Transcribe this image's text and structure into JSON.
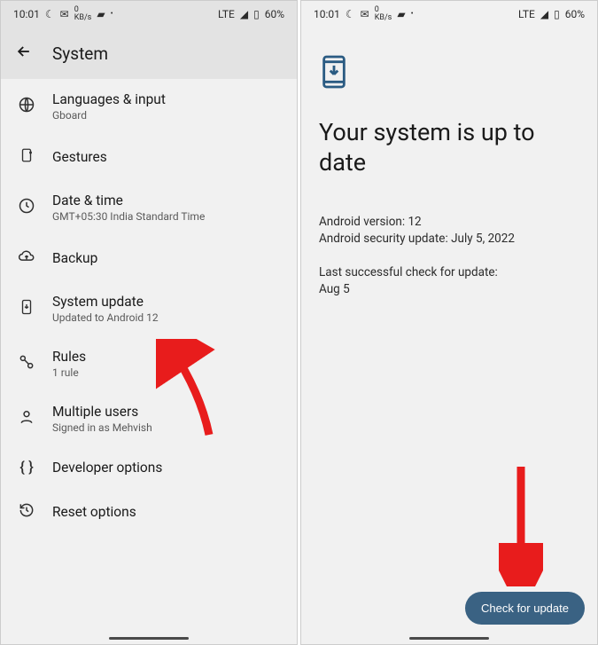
{
  "statusbar": {
    "time": "10:01",
    "network_label": "LTE",
    "battery": "60%",
    "data_rate": "0",
    "data_unit": "KB/s"
  },
  "screen1": {
    "title": "System",
    "items": [
      {
        "icon": "globe-icon",
        "title": "Languages & input",
        "sub": "Gboard"
      },
      {
        "icon": "gesture-icon",
        "title": "Gestures",
        "sub": ""
      },
      {
        "icon": "clock-icon",
        "title": "Date & time",
        "sub": "GMT+05:30 India Standard Time"
      },
      {
        "icon": "cloud-upload-icon",
        "title": "Backup",
        "sub": ""
      },
      {
        "icon": "phone-download-icon",
        "title": "System update",
        "sub": "Updated to Android 12"
      },
      {
        "icon": "rules-icon",
        "title": "Rules",
        "sub": "1 rule"
      },
      {
        "icon": "person-icon",
        "title": "Multiple users",
        "sub": "Signed in as Mehvish"
      },
      {
        "icon": "braces-icon",
        "title": "Developer options",
        "sub": ""
      },
      {
        "icon": "history-icon",
        "title": "Reset options",
        "sub": ""
      }
    ]
  },
  "screen2": {
    "title": "Your system is up to date",
    "android_version_label": "Android version: 12",
    "security_label": "Android security update: July 5, 2022",
    "last_check_label": "Last successful check for update:",
    "last_check_date": "Aug 5",
    "button": "Check for update"
  }
}
